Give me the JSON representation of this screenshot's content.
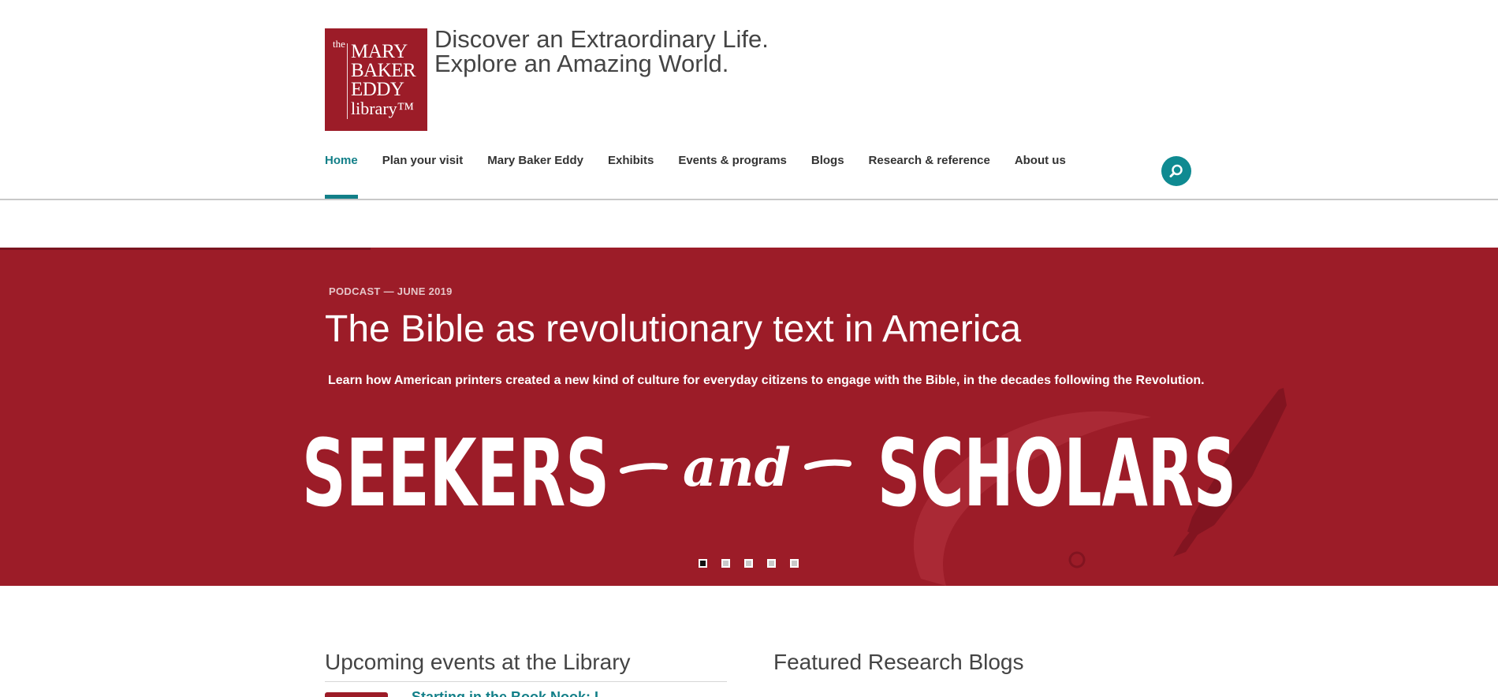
{
  "brand": {
    "logo_the": "the",
    "logo_line1": "MARY",
    "logo_line2": "BAKER",
    "logo_line3": "EDDY",
    "logo_line4": "library™",
    "tagline_1": "Discover an Extraordinary Life.",
    "tagline_2": "Explore an Amazing World."
  },
  "nav": {
    "items": [
      {
        "label": "Home",
        "active": true
      },
      {
        "label": "Plan your visit"
      },
      {
        "label": "Mary Baker Eddy"
      },
      {
        "label": "Exhibits"
      },
      {
        "label": "Events & programs"
      },
      {
        "label": "Blogs"
      },
      {
        "label": "Research & reference"
      },
      {
        "label": "About us"
      }
    ],
    "search_icon": "search-icon"
  },
  "hero": {
    "kicker": "PODCAST — JUNE 2019",
    "headline": "The Bible as revolutionary text in America",
    "subtitle": "Learn how American printers created a new kind of culture for everyday citizens to engage with the Bible, in the decades following the Revolution.",
    "art_left": "SEEKERS",
    "art_middle": "and",
    "art_right": "SCHOLARS",
    "slides": 5,
    "active_slide": 1
  },
  "sections": {
    "events_title": "Upcoming events at the Library",
    "blogs_title": "Featured Research Blogs",
    "first_event_title": "Starting in the Book Nook: L..."
  },
  "colors": {
    "brand_red": "#9c1c28",
    "accent_teal": "#127f88"
  }
}
